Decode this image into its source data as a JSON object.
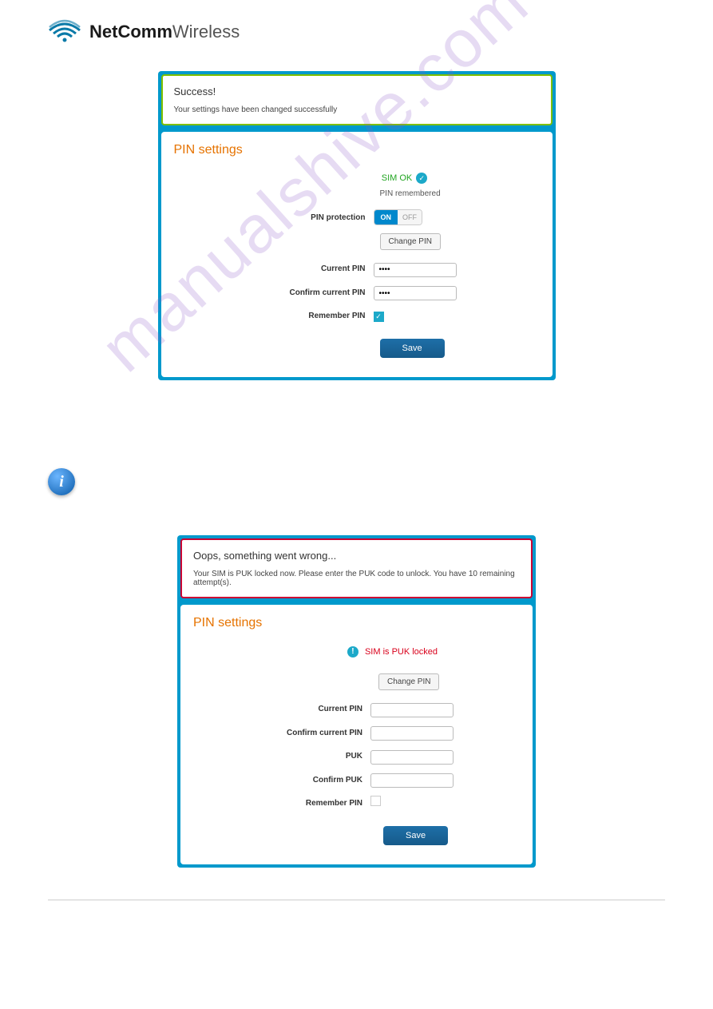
{
  "logo": {
    "bold": "NetComm",
    "light": "Wireless"
  },
  "watermark": "manualshive.com",
  "box1": {
    "banner_title": "Success!",
    "banner_text": "Your settings have been changed successfully",
    "panel_title": "PIN settings",
    "sim_ok": "SIM OK",
    "remembered": "PIN remembered",
    "labels": {
      "pin_protection": "PIN protection",
      "current_pin": "Current PIN",
      "confirm_current_pin": "Confirm current PIN",
      "remember_pin": "Remember PIN"
    },
    "toggle_on": "ON",
    "toggle_off": "OFF",
    "change_pin": "Change PIN",
    "current_pin_val": "••••",
    "confirm_pin_val": "••••",
    "save": "Save"
  },
  "box2": {
    "banner_title": "Oops, something went wrong...",
    "banner_text": "Your SIM is PUK locked now. Please enter the PUK code to unlock. You have 10 remaining attempt(s).",
    "panel_title": "PIN settings",
    "sim_locked": "SIM is PUK locked",
    "change_pin": "Change PIN",
    "labels": {
      "current_pin": "Current PIN",
      "confirm_current_pin": "Confirm current PIN",
      "puk": "PUK",
      "confirm_puk": "Confirm PUK",
      "remember_pin": "Remember PIN"
    },
    "save": "Save"
  }
}
